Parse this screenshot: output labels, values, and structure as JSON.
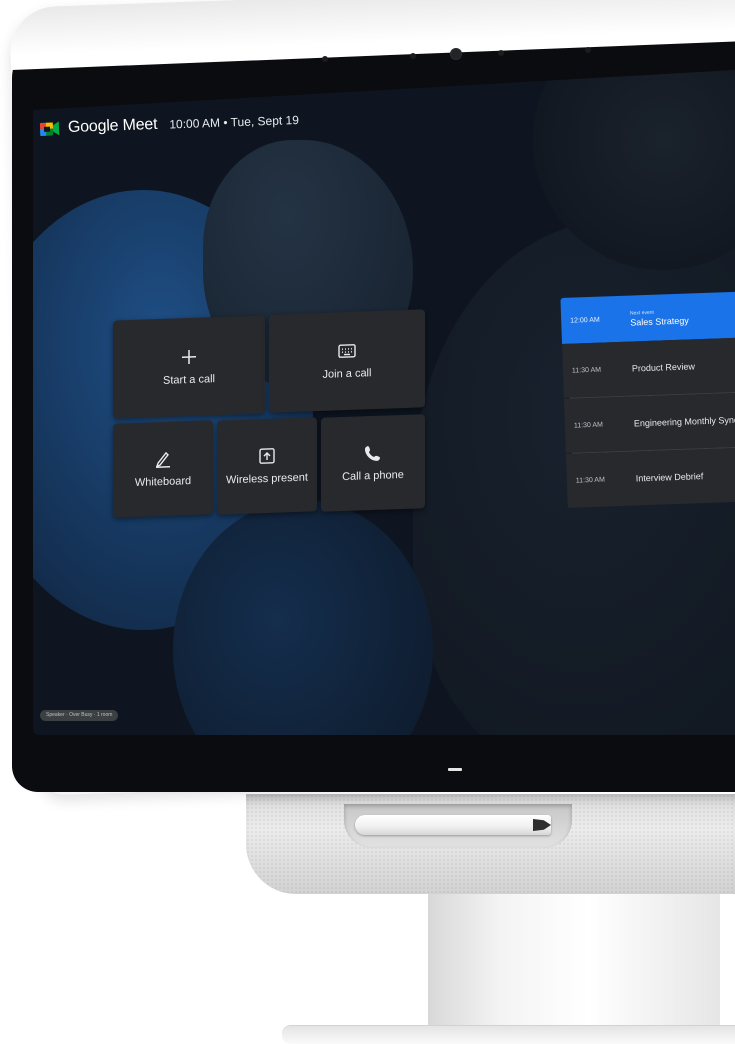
{
  "header": {
    "app_name": "Google Meet",
    "datetime": "10:00 AM • Tue, Sept 19"
  },
  "actions": {
    "start_call": {
      "label": "Start a call",
      "icon": "plus-icon"
    },
    "join_call": {
      "label": "Join a call",
      "icon": "keyboard-icon"
    },
    "whiteboard": {
      "label": "Whiteboard",
      "icon": "pen-icon"
    },
    "wireless_present": {
      "label": "Wireless present",
      "icon": "present-upload-icon"
    },
    "call_phone": {
      "label": "Call a phone",
      "icon": "phone-icon"
    }
  },
  "agenda": {
    "items": [
      {
        "time": "12:00 AM",
        "kicker": "Next event",
        "title": "Sales Strategy",
        "active": true
      },
      {
        "time": "11:30 AM",
        "title": "Product Review",
        "active": false
      },
      {
        "time": "11:30 AM",
        "title": "Engineering Monthly Sync",
        "active": false
      },
      {
        "time": "11:30 AM",
        "title": "Interview Debrief",
        "active": false
      }
    ]
  },
  "status": {
    "room_label": "Speaker · Over Busy · 1 room"
  },
  "colors": {
    "screen_bg": "#0e1520",
    "tile_bg": "#27292d",
    "accent": "#1a73e8",
    "text": "#e8eaed"
  }
}
